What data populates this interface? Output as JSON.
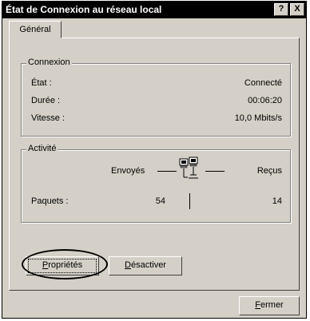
{
  "window": {
    "title": "État de Connexion au réseau local",
    "help_button": "?",
    "close_button": "X"
  },
  "tabs": [
    {
      "label": "Général",
      "active": true
    }
  ],
  "connexion": {
    "label": "Connexion",
    "rows": [
      {
        "label": "État :",
        "value": "Connecté"
      },
      {
        "label": "Durée :",
        "value": "00:06:20"
      },
      {
        "label": "Vitesse :",
        "value": "10,0 Mbits/s"
      }
    ]
  },
  "activite": {
    "label": "Activité",
    "sent_label": "Envoyés",
    "received_label": "Reçus",
    "packets_label": "Paquets :",
    "packets_sent": "54",
    "packets_received": "14",
    "icon": "network-computers-icon"
  },
  "buttons": {
    "proprietes_first": "P",
    "proprietes_rest": "ropriétés",
    "desactiver_first": "D",
    "desactiver_rest": "ésactiver",
    "fermer_first": "F",
    "fermer_rest": "ermer"
  }
}
